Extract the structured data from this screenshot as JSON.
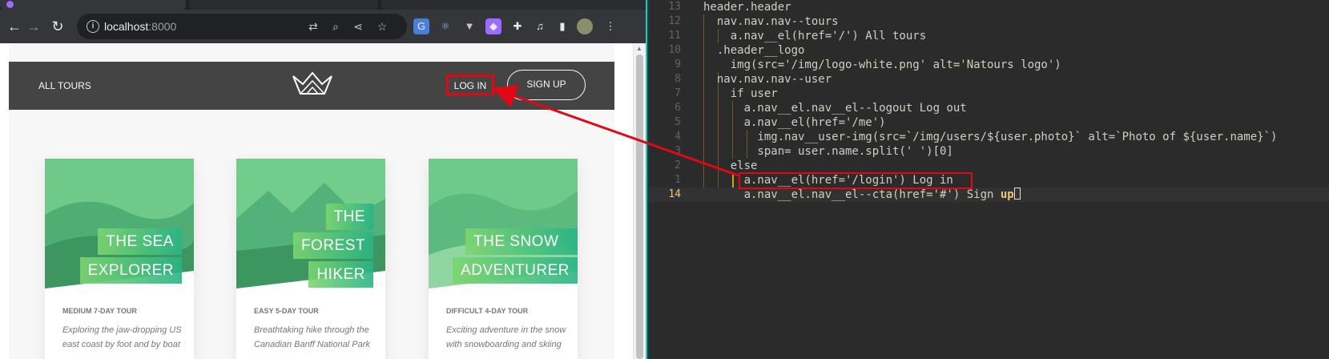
{
  "browser": {
    "url_host": "localhost",
    "url_port": ":8000"
  },
  "site": {
    "nav": {
      "all_tours": "ALL TOURS",
      "log_in": "LOG IN",
      "sign_up": "SIGN UP"
    },
    "cards": [
      {
        "title_lines": [
          "THE SEA",
          "EXPLORER"
        ],
        "subheading": "MEDIUM 7-DAY TOUR",
        "description": "Exploring the jaw-dropping US east coast by foot and by boat"
      },
      {
        "title_lines": [
          "THE",
          "FOREST",
          "HIKER"
        ],
        "subheading": "EASY 5-DAY TOUR",
        "description": "Breathtaking hike through the Canadian Banff National Park"
      },
      {
        "title_lines": [
          "THE SNOW",
          "ADVENTURER"
        ],
        "subheading": "DIFFICULT 4-DAY TOUR",
        "description": "Exciting adventure in the snow with snowboarding and skiing"
      }
    ]
  },
  "editor": {
    "lines": [
      {
        "num": "13",
        "text": "header.header"
      },
      {
        "num": "12",
        "text": "  nav.nav.nav--tours"
      },
      {
        "num": "11",
        "text": "    a.nav__el(href='/') All tours"
      },
      {
        "num": "10",
        "text": "  .header__logo"
      },
      {
        "num": "9",
        "text": "    img(src='/img/logo-white.png' alt='Natours logo')"
      },
      {
        "num": "8",
        "text": "  nav.nav.nav--user"
      },
      {
        "num": "7",
        "text": "    if user"
      },
      {
        "num": "6",
        "text": "      a.nav__el.nav__el--logout Log out"
      },
      {
        "num": "5",
        "text": "      a.nav__el(href='/me')"
      },
      {
        "num": "4",
        "text": "        img.nav__user-img(src=`/img/users/${user.photo}` alt=`Photo of ${user.name}`)"
      },
      {
        "num": "3",
        "text": "        span= user.name.split(' ')[0]"
      },
      {
        "num": "2",
        "text": "    else"
      },
      {
        "num": "1",
        "text": "      a.nav__el(href='/login') Log in"
      },
      {
        "num": "14",
        "text": "      a.nav__el.nav__el--cta(href='#') Sign ",
        "highlight": "up"
      }
    ]
  },
  "colors": {
    "annotation_red": "#e30613",
    "header_gray": "#444444",
    "accent_green": "#55c57a"
  }
}
